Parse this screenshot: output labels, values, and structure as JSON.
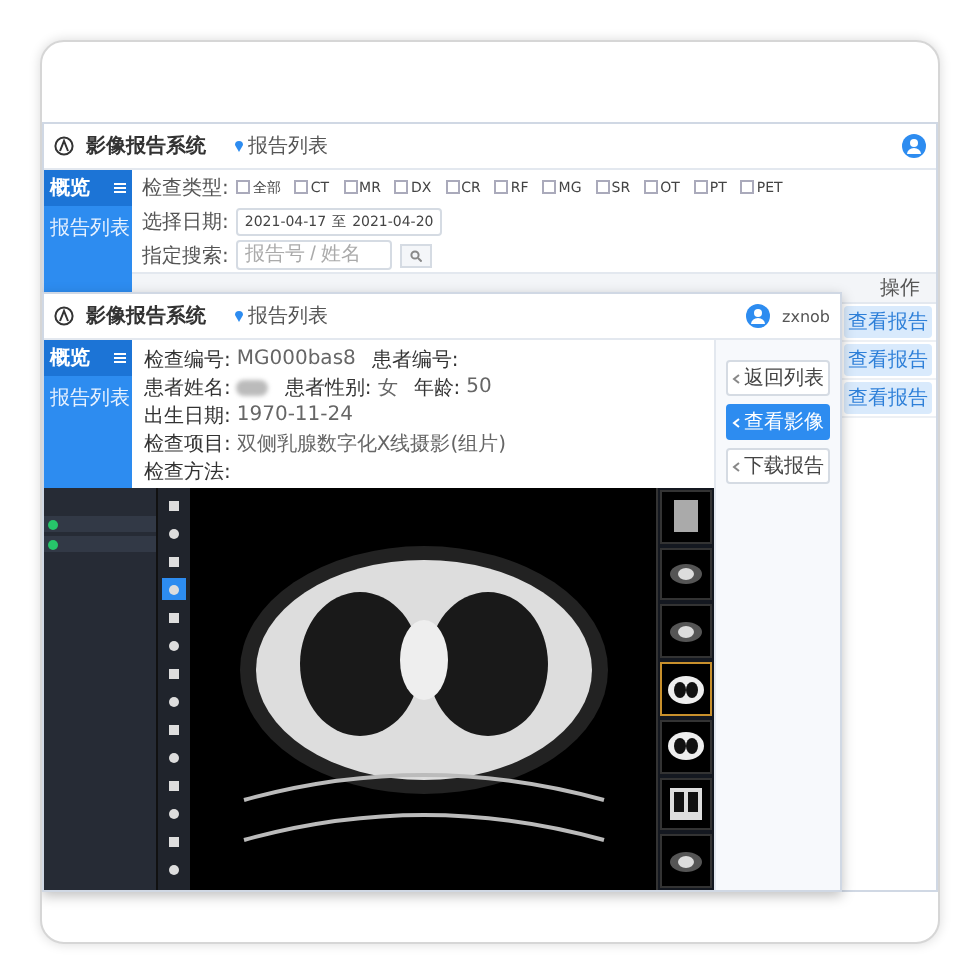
{
  "back_window": {
    "title": "影像报告系统",
    "breadcrumb": "报告列表",
    "sidebar": {
      "heading": "概览",
      "items": [
        {
          "label": "报告列表"
        }
      ]
    },
    "filters": {
      "type_label": "检查类型:",
      "types": [
        {
          "label": "全部",
          "checked": false
        },
        {
          "label": "CT",
          "checked": false
        },
        {
          "label": "MR",
          "checked": false
        },
        {
          "label": "DX",
          "checked": false
        },
        {
          "label": "CR",
          "checked": false
        },
        {
          "label": "RF",
          "checked": false
        },
        {
          "label": "MG",
          "checked": false
        },
        {
          "label": "SR",
          "checked": false
        },
        {
          "label": "OT",
          "checked": false
        },
        {
          "label": "PT",
          "checked": false
        },
        {
          "label": "PET",
          "checked": false
        }
      ],
      "date_label": "选择日期:",
      "date_from": "2021-04-17",
      "date_sep": "至",
      "date_to": "2021-04-20",
      "search_label": "指定搜索:",
      "search_placeholder": "报告号 / 姓名"
    },
    "action_column": "操作",
    "action_buttons": [
      "查看报告",
      "查看报告",
      "查看报告"
    ]
  },
  "front_window": {
    "title": "影像报告系统",
    "breadcrumb": "报告列表",
    "user": "zxnob",
    "sidebar": {
      "heading": "概览",
      "items": [
        {
          "label": "报告列表"
        }
      ]
    },
    "details": [
      [
        {
          "label": "检查编号:",
          "value": "MG000bas8"
        },
        {
          "label": "患者编号:"
        }
      ],
      [
        {
          "label": "患者姓名:",
          "redacted": true
        },
        {
          "label": "患者性别:",
          "value": "女"
        },
        {
          "label": "年龄:",
          "value": "50"
        }
      ],
      [
        {
          "label": "出生日期:",
          "value": "1970-11-24"
        }
      ],
      [
        {
          "label": "检查项目:",
          "value": "双侧乳腺数字化X线摄影(组片)"
        }
      ],
      [
        {
          "label": "检查方法:"
        }
      ]
    ],
    "actions": [
      {
        "label": "返回列表",
        "selected": false
      },
      {
        "label": "查看影像",
        "selected": true
      },
      {
        "label": "下载报告",
        "selected": false
      }
    ],
    "viewer": {
      "tools": [
        {
          "selected": false
        },
        {
          "selected": false
        },
        {
          "selected": false
        },
        {
          "selected": true
        },
        {
          "selected": false
        },
        {
          "selected": false
        },
        {
          "selected": false
        },
        {
          "selected": false
        },
        {
          "selected": false
        },
        {
          "selected": false
        },
        {
          "selected": false
        },
        {
          "selected": false
        },
        {
          "selected": false
        },
        {
          "selected": false
        }
      ],
      "thumbnails": [
        {
          "kind": "scout",
          "selected": false
        },
        {
          "kind": "abdomen",
          "selected": false
        },
        {
          "kind": "abdomen",
          "selected": false
        },
        {
          "kind": "chest",
          "selected": true
        },
        {
          "kind": "chest",
          "selected": false
        },
        {
          "kind": "coronal",
          "selected": false
        },
        {
          "kind": "abdomen",
          "selected": false
        }
      ]
    }
  }
}
